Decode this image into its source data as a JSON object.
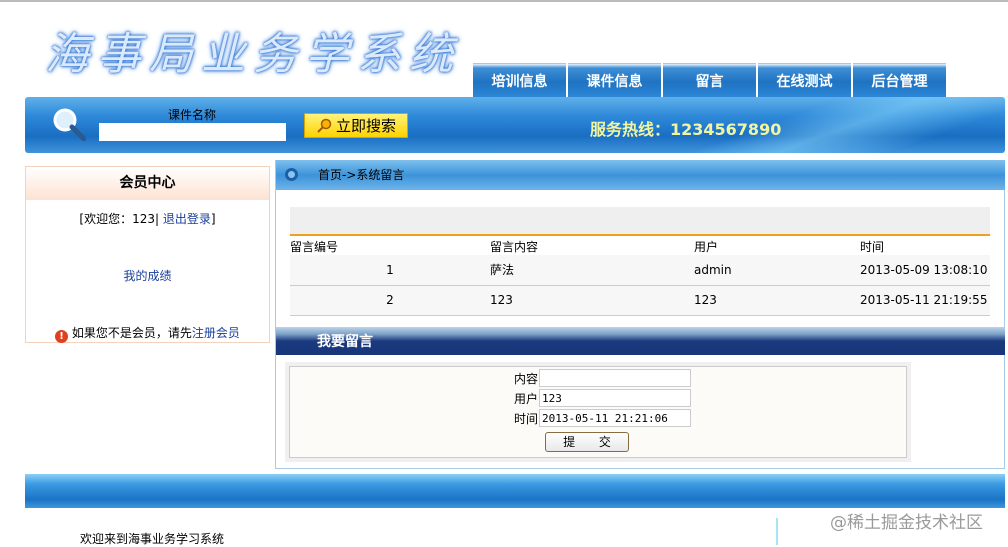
{
  "header": {
    "logo": "海事局业务学系统",
    "hotline": "服务热线：1234567890"
  },
  "nav": {
    "tabs": [
      "培训信息",
      "课件信息",
      "留言",
      "在线测试",
      "后台管理"
    ]
  },
  "search": {
    "label": "课件名称",
    "value": "",
    "button": "立即搜索"
  },
  "member": {
    "title": "会员中心",
    "welcome_prefix": "[欢迎您：123|",
    "logout": "退出登录",
    "welcome_suffix": "]",
    "scores": "我的成绩",
    "notice": "如果您不是会员，请先",
    "register": "注册会员"
  },
  "breadcrumb": "首页->系统留言",
  "messages": {
    "headers": [
      "留言编号",
      "留言内容",
      "用户",
      "时间"
    ],
    "rows": [
      [
        "1",
        "萨法",
        "admin",
        "2013-05-09 13:08:10"
      ],
      [
        "2",
        "123",
        "123",
        "2013-05-11 21:19:55"
      ]
    ]
  },
  "form": {
    "title": "我要留言",
    "content_label": "内容",
    "content_value": "",
    "user_label": "用户",
    "user_value": "123",
    "time_label": "时间",
    "time_value": "2013-05-11 21:21:06",
    "submit": "提 交"
  },
  "footer": {
    "text": "欢迎来到海事业务学习系统"
  },
  "watermark": "@稀土掘金技术社区"
}
